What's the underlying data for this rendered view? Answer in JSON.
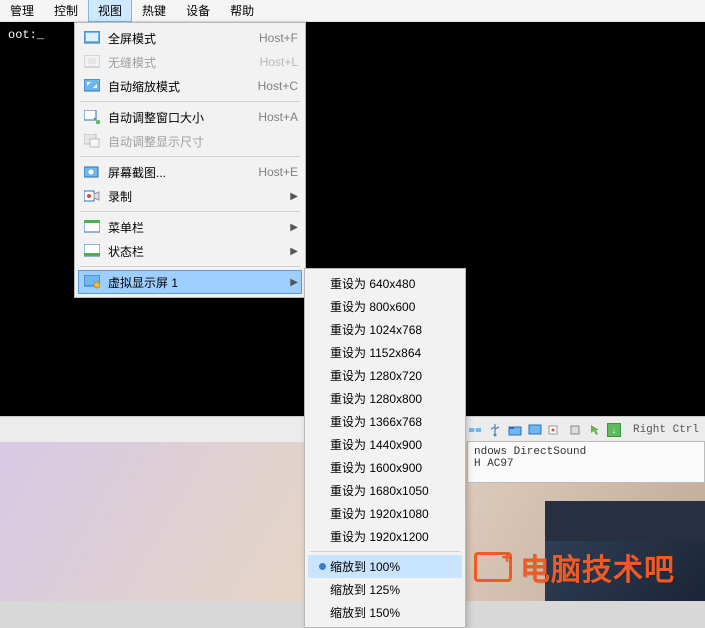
{
  "menubar": {
    "items": [
      "管理",
      "控制",
      "视图",
      "热键",
      "设备",
      "帮助"
    ],
    "active_index": 2
  },
  "terminal": {
    "line": "oot:_"
  },
  "view_menu": {
    "groups": [
      [
        {
          "icon": "fullscreen",
          "label": "全屏模式",
          "shortcut": "Host+F",
          "has_sub": false,
          "disabled": false
        },
        {
          "icon": "seamless",
          "label": "无缝模式",
          "shortcut": "Host+L",
          "has_sub": false,
          "disabled": true
        },
        {
          "icon": "scale",
          "label": "自动缩放模式",
          "shortcut": "Host+C",
          "has_sub": false,
          "disabled": false
        }
      ],
      [
        {
          "icon": "autosize",
          "label": "自动调整窗口大小",
          "shortcut": "Host+A",
          "has_sub": false,
          "disabled": false
        },
        {
          "icon": "resize-guest",
          "label": "自动调整显示尺寸",
          "shortcut": "",
          "has_sub": false,
          "disabled": true
        }
      ],
      [
        {
          "icon": "screenshot",
          "label": "屏幕截图...",
          "shortcut": "Host+E",
          "has_sub": false,
          "disabled": false
        },
        {
          "icon": "record",
          "label": "录制",
          "shortcut": "",
          "has_sub": true,
          "disabled": false
        }
      ],
      [
        {
          "icon": "menubar-toggle",
          "label": "菜单栏",
          "shortcut": "",
          "has_sub": true,
          "disabled": false
        },
        {
          "icon": "statusbar-toggle",
          "label": "状态栏",
          "shortcut": "",
          "has_sub": true,
          "disabled": false
        }
      ],
      [
        {
          "icon": "display",
          "label": "虚拟显示屏 1",
          "shortcut": "",
          "has_sub": true,
          "disabled": false,
          "highlight": true
        }
      ]
    ]
  },
  "display_submenu": {
    "resize": [
      "重设为 640x480",
      "重设为 800x600",
      "重设为 1024x768",
      "重设为 1152x864",
      "重设为 1280x720",
      "重设为 1280x800",
      "重设为 1366x768",
      "重设为 1440x900",
      "重设为 1600x900",
      "重设为 1680x1050",
      "重设为 1920x1080",
      "重设为 1920x1200"
    ],
    "scale": [
      {
        "label": "缩放到 100%",
        "selected": true
      },
      {
        "label": "缩放到 125%",
        "selected": false
      },
      {
        "label": "缩放到 150%",
        "selected": false
      }
    ]
  },
  "sound_info": {
    "line1": "ndows DirectSound",
    "line2": "H AC97"
  },
  "statusbar": {
    "host_key": "Right Ctrl"
  },
  "watermark": {
    "text": "电脑技术吧"
  },
  "icon_colors": {
    "monitor_fill": "#6fb7ef",
    "monitor_border": "#2a71b8",
    "disabled": "#bcbcbc",
    "green": "#4caf50",
    "record": "#e04a3a"
  }
}
